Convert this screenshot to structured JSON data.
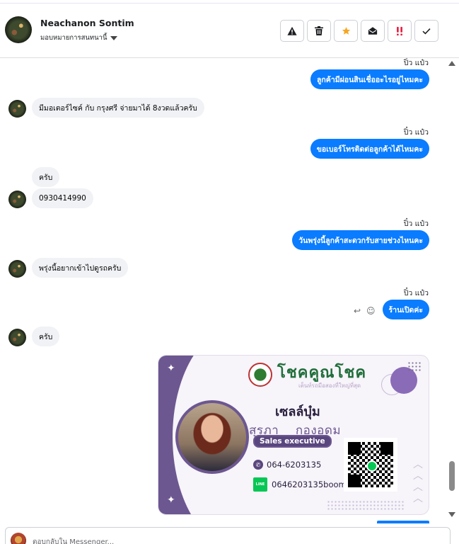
{
  "header": {
    "contact_name": "Neachanon Sontim",
    "assign_label": "มอบหมายการสนทนานี้",
    "toolbar": [
      {
        "name": "report-spam-button",
        "icon": "warning-icon"
      },
      {
        "name": "delete-button",
        "icon": "trash-icon"
      },
      {
        "name": "star-button",
        "icon": "star-icon",
        "color": "#f5a623"
      },
      {
        "name": "mark-unread-button",
        "icon": "envelope-open-icon"
      },
      {
        "name": "follow-up-button",
        "icon": "exclamation-icon",
        "color": "#e41e3f"
      },
      {
        "name": "mark-done-button",
        "icon": "check-icon"
      }
    ]
  },
  "messages": [
    {
      "direction": "out",
      "seen": "ปิ๋ว แป๋ว",
      "text": "ลูกค้ามีผ่อนสินเชื่ออะไรอยู่ไหมคะ"
    },
    {
      "direction": "in",
      "text": "มีมอเตอร์ไซค์ กับ กรุงศรี จ่ายมาได้ 8งวดแล้วครับ"
    },
    {
      "direction": "out",
      "seen": "ปิ๋ว แป๋ว",
      "text": "ขอเบอร์โทรติดต่อลูกค้าได้ไหมคะ"
    },
    {
      "direction": "in",
      "text": "ครับ"
    },
    {
      "direction": "in",
      "text": "0930414990"
    },
    {
      "direction": "out",
      "seen": "ปิ๋ว แป๋ว",
      "text": "วันพรุ่งนี้ลูกค้าสะดวกรับสายช่วงไหนคะ"
    },
    {
      "direction": "in",
      "text": "พรุ่งนี้อยากเข้าไปดูรถครับ"
    },
    {
      "direction": "out",
      "seen": "ปิ๋ว แป๋ว",
      "text": "ร้านเปิดค่ะ"
    },
    {
      "direction": "in",
      "text": "ครับ"
    }
  ],
  "business_card": {
    "brand": "โชคคูณโชค",
    "tagline": "เต็นท์รถมือสองที่ใหญ่ที่สุด",
    "nickname": "เซลล์บุ๋ม",
    "full_name": "สุรภา    กองอุดม",
    "job_title": "Sales executive",
    "phone": "064-6203135",
    "line_id": "0646203135boom",
    "line_badge": "LINE"
  },
  "composer": {
    "placeholder": "ตอบกลับใน Messenger..."
  }
}
